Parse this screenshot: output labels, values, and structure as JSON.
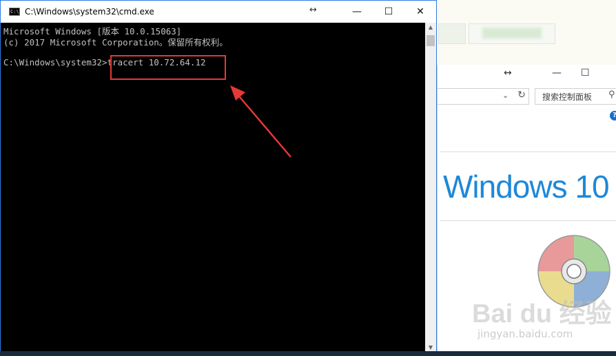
{
  "cmd": {
    "title": "C:\\Windows\\system32\\cmd.exe",
    "icon_text": "C:\\",
    "line1": "Microsoft Windows [版本 10.0.15063]",
    "line2": "(c) 2017 Microsoft Corporation。保留所有权利。",
    "prompt": "C:\\Windows\\system32>",
    "command": "tracert 10.72.64.12",
    "controls": {
      "minimize": "—",
      "maximize": "☐",
      "close": "✕",
      "resize": "↔"
    }
  },
  "control_panel": {
    "search_placeholder": "搜索控制面板",
    "logo_text": "Windows 10",
    "help": "?",
    "controls": {
      "resize": "↔",
      "minimize": "—",
      "maximize": "☐"
    }
  },
  "watermark": {
    "text": "Bai du 经验",
    "sub": "jingyan.baidu.com"
  },
  "colors": {
    "highlight": "#e53935",
    "console_bg": "#000000",
    "console_text": "#c0c0c0",
    "windows_blue": "#1e88d8"
  }
}
